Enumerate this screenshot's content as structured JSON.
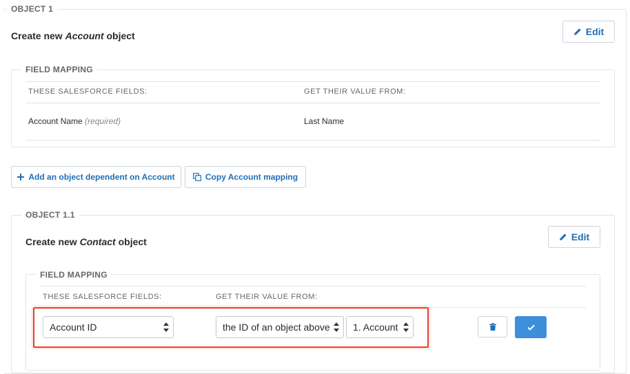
{
  "object1": {
    "legend": "OBJECT 1",
    "title_prefix": "Create new ",
    "title_object": "Account",
    "title_suffix": " object",
    "edit_label": "Edit",
    "field_mapping": {
      "legend": "FIELD MAPPING",
      "col_sf": "THESE SALESFORCE FIELDS:",
      "col_value": "GET THEIR VALUE FROM:",
      "row": {
        "field": "Account Name",
        "required": "(required)",
        "value": "Last Name"
      }
    }
  },
  "actions": {
    "add_dependent_label": "Add an object dependent on Account",
    "copy_mapping_label": "Copy Account mapping"
  },
  "object11": {
    "legend": "OBJECT 1.1",
    "title_prefix": "Create new ",
    "title_object": "Contact",
    "title_suffix": " object",
    "edit_label": "Edit",
    "field_mapping": {
      "legend": "FIELD MAPPING",
      "col_sf": "THESE SALESFORCE FIELDS:",
      "col_value": "GET THEIR VALUE FROM:",
      "row": {
        "field_select": "Account ID",
        "value_select": "the ID of an object above",
        "object_select": "1. Account"
      }
    }
  },
  "colors": {
    "accent": "#1f6fb5",
    "confirm": "#3d8fdb",
    "highlight": "#e8402c"
  },
  "icons": {
    "edit": "pencil-icon",
    "add": "plus-icon",
    "copy": "copy-icon",
    "delete": "trash-icon",
    "confirm": "check-icon"
  }
}
